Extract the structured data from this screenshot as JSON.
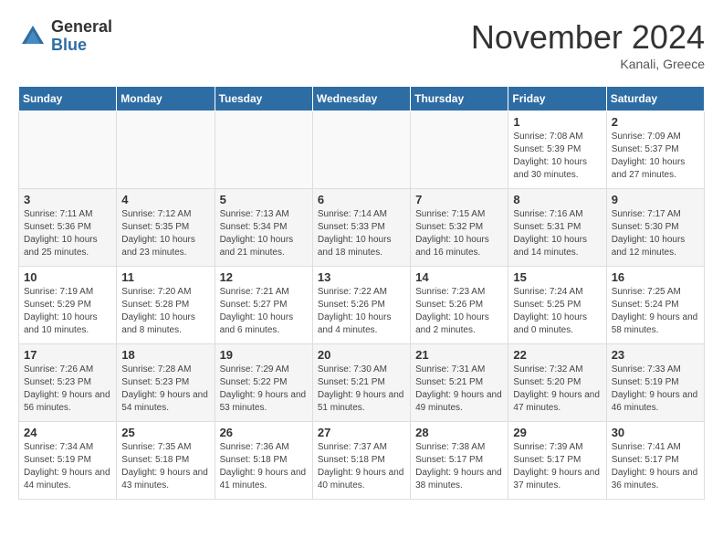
{
  "header": {
    "logo_general": "General",
    "logo_blue": "Blue",
    "title": "November 2024",
    "location": "Kanali, Greece"
  },
  "weekdays": [
    "Sunday",
    "Monday",
    "Tuesday",
    "Wednesday",
    "Thursday",
    "Friday",
    "Saturday"
  ],
  "weeks": [
    [
      {
        "day": "",
        "empty": true
      },
      {
        "day": "",
        "empty": true
      },
      {
        "day": "",
        "empty": true
      },
      {
        "day": "",
        "empty": true
      },
      {
        "day": "",
        "empty": true
      },
      {
        "day": "1",
        "sunrise": "Sunrise: 7:08 AM",
        "sunset": "Sunset: 5:39 PM",
        "daylight": "Daylight: 10 hours and 30 minutes."
      },
      {
        "day": "2",
        "sunrise": "Sunrise: 7:09 AM",
        "sunset": "Sunset: 5:37 PM",
        "daylight": "Daylight: 10 hours and 27 minutes."
      }
    ],
    [
      {
        "day": "3",
        "sunrise": "Sunrise: 7:11 AM",
        "sunset": "Sunset: 5:36 PM",
        "daylight": "Daylight: 10 hours and 25 minutes."
      },
      {
        "day": "4",
        "sunrise": "Sunrise: 7:12 AM",
        "sunset": "Sunset: 5:35 PM",
        "daylight": "Daylight: 10 hours and 23 minutes."
      },
      {
        "day": "5",
        "sunrise": "Sunrise: 7:13 AM",
        "sunset": "Sunset: 5:34 PM",
        "daylight": "Daylight: 10 hours and 21 minutes."
      },
      {
        "day": "6",
        "sunrise": "Sunrise: 7:14 AM",
        "sunset": "Sunset: 5:33 PM",
        "daylight": "Daylight: 10 hours and 18 minutes."
      },
      {
        "day": "7",
        "sunrise": "Sunrise: 7:15 AM",
        "sunset": "Sunset: 5:32 PM",
        "daylight": "Daylight: 10 hours and 16 minutes."
      },
      {
        "day": "8",
        "sunrise": "Sunrise: 7:16 AM",
        "sunset": "Sunset: 5:31 PM",
        "daylight": "Daylight: 10 hours and 14 minutes."
      },
      {
        "day": "9",
        "sunrise": "Sunrise: 7:17 AM",
        "sunset": "Sunset: 5:30 PM",
        "daylight": "Daylight: 10 hours and 12 minutes."
      }
    ],
    [
      {
        "day": "10",
        "sunrise": "Sunrise: 7:19 AM",
        "sunset": "Sunset: 5:29 PM",
        "daylight": "Daylight: 10 hours and 10 minutes."
      },
      {
        "day": "11",
        "sunrise": "Sunrise: 7:20 AM",
        "sunset": "Sunset: 5:28 PM",
        "daylight": "Daylight: 10 hours and 8 minutes."
      },
      {
        "day": "12",
        "sunrise": "Sunrise: 7:21 AM",
        "sunset": "Sunset: 5:27 PM",
        "daylight": "Daylight: 10 hours and 6 minutes."
      },
      {
        "day": "13",
        "sunrise": "Sunrise: 7:22 AM",
        "sunset": "Sunset: 5:26 PM",
        "daylight": "Daylight: 10 hours and 4 minutes."
      },
      {
        "day": "14",
        "sunrise": "Sunrise: 7:23 AM",
        "sunset": "Sunset: 5:26 PM",
        "daylight": "Daylight: 10 hours and 2 minutes."
      },
      {
        "day": "15",
        "sunrise": "Sunrise: 7:24 AM",
        "sunset": "Sunset: 5:25 PM",
        "daylight": "Daylight: 10 hours and 0 minutes."
      },
      {
        "day": "16",
        "sunrise": "Sunrise: 7:25 AM",
        "sunset": "Sunset: 5:24 PM",
        "daylight": "Daylight: 9 hours and 58 minutes."
      }
    ],
    [
      {
        "day": "17",
        "sunrise": "Sunrise: 7:26 AM",
        "sunset": "Sunset: 5:23 PM",
        "daylight": "Daylight: 9 hours and 56 minutes."
      },
      {
        "day": "18",
        "sunrise": "Sunrise: 7:28 AM",
        "sunset": "Sunset: 5:23 PM",
        "daylight": "Daylight: 9 hours and 54 minutes."
      },
      {
        "day": "19",
        "sunrise": "Sunrise: 7:29 AM",
        "sunset": "Sunset: 5:22 PM",
        "daylight": "Daylight: 9 hours and 53 minutes."
      },
      {
        "day": "20",
        "sunrise": "Sunrise: 7:30 AM",
        "sunset": "Sunset: 5:21 PM",
        "daylight": "Daylight: 9 hours and 51 minutes."
      },
      {
        "day": "21",
        "sunrise": "Sunrise: 7:31 AM",
        "sunset": "Sunset: 5:21 PM",
        "daylight": "Daylight: 9 hours and 49 minutes."
      },
      {
        "day": "22",
        "sunrise": "Sunrise: 7:32 AM",
        "sunset": "Sunset: 5:20 PM",
        "daylight": "Daylight: 9 hours and 47 minutes."
      },
      {
        "day": "23",
        "sunrise": "Sunrise: 7:33 AM",
        "sunset": "Sunset: 5:19 PM",
        "daylight": "Daylight: 9 hours and 46 minutes."
      }
    ],
    [
      {
        "day": "24",
        "sunrise": "Sunrise: 7:34 AM",
        "sunset": "Sunset: 5:19 PM",
        "daylight": "Daylight: 9 hours and 44 minutes."
      },
      {
        "day": "25",
        "sunrise": "Sunrise: 7:35 AM",
        "sunset": "Sunset: 5:18 PM",
        "daylight": "Daylight: 9 hours and 43 minutes."
      },
      {
        "day": "26",
        "sunrise": "Sunrise: 7:36 AM",
        "sunset": "Sunset: 5:18 PM",
        "daylight": "Daylight: 9 hours and 41 minutes."
      },
      {
        "day": "27",
        "sunrise": "Sunrise: 7:37 AM",
        "sunset": "Sunset: 5:18 PM",
        "daylight": "Daylight: 9 hours and 40 minutes."
      },
      {
        "day": "28",
        "sunrise": "Sunrise: 7:38 AM",
        "sunset": "Sunset: 5:17 PM",
        "daylight": "Daylight: 9 hours and 38 minutes."
      },
      {
        "day": "29",
        "sunrise": "Sunrise: 7:39 AM",
        "sunset": "Sunset: 5:17 PM",
        "daylight": "Daylight: 9 hours and 37 minutes."
      },
      {
        "day": "30",
        "sunrise": "Sunrise: 7:41 AM",
        "sunset": "Sunset: 5:17 PM",
        "daylight": "Daylight: 9 hours and 36 minutes."
      }
    ]
  ]
}
